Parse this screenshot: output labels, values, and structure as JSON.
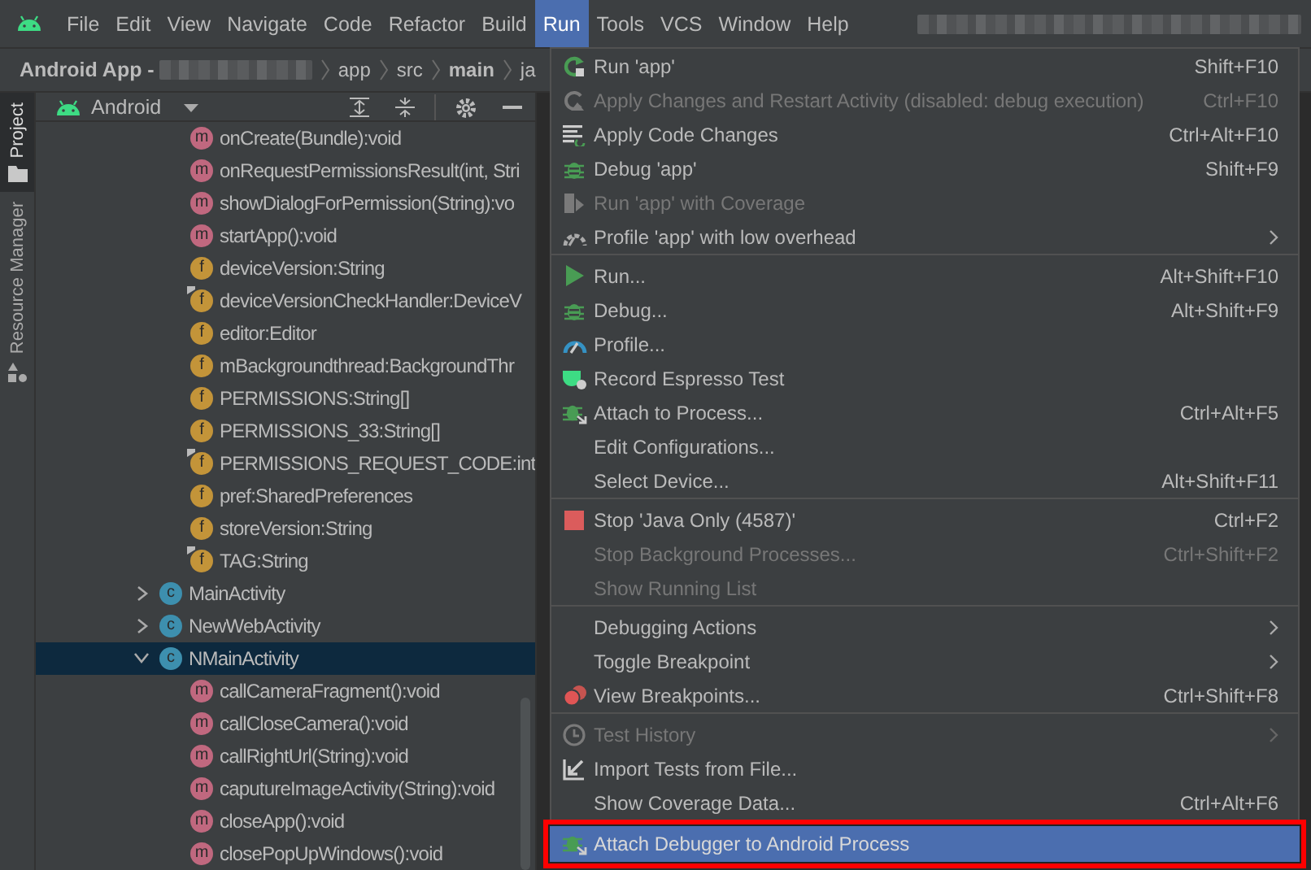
{
  "menu_bar": {
    "items": [
      {
        "label": "File",
        "selected": false
      },
      {
        "label": "Edit",
        "selected": false
      },
      {
        "label": "View",
        "selected": false
      },
      {
        "label": "Navigate",
        "selected": false
      },
      {
        "label": "Code",
        "selected": false
      },
      {
        "label": "Refactor",
        "selected": false
      },
      {
        "label": "Build",
        "selected": false
      },
      {
        "label": "Run",
        "selected": true
      },
      {
        "label": "Tools",
        "selected": false
      },
      {
        "label": "VCS",
        "selected": false
      },
      {
        "label": "Window",
        "selected": false
      },
      {
        "label": "Help",
        "selected": false
      }
    ]
  },
  "breadcrumbs": {
    "project": "Android App -",
    "parts": [
      "app",
      "src",
      "main",
      "ja"
    ]
  },
  "side_tabs": [
    {
      "label": "Project",
      "selected": true
    },
    {
      "label": "Resource Manager",
      "selected": false
    }
  ],
  "project_panel": {
    "view": "Android",
    "members": [
      {
        "label": "onCreate(Bundle):void",
        "kind": "method",
        "badge": "m",
        "static": false
      },
      {
        "label": "onRequestPermissionsResult(int, Stri",
        "kind": "method",
        "badge": "m",
        "static": false
      },
      {
        "label": "showDialogForPermission(String):vo",
        "kind": "method",
        "badge": "m",
        "static": false
      },
      {
        "label": "startApp():void",
        "kind": "method",
        "badge": "m",
        "static": false
      },
      {
        "label": "deviceVersion:String",
        "kind": "field",
        "badge": "f",
        "static": false
      },
      {
        "label": "deviceVersionCheckHandler:DeviceV",
        "kind": "field",
        "badge": "f",
        "static": true
      },
      {
        "label": "editor:Editor",
        "kind": "field",
        "badge": "f",
        "static": false
      },
      {
        "label": "mBackgroundthread:BackgroundThr",
        "kind": "field",
        "badge": "f",
        "static": false
      },
      {
        "label": "PERMISSIONS:String[]",
        "kind": "field",
        "badge": "f",
        "static": false
      },
      {
        "label": "PERMISSIONS_33:String[]",
        "kind": "field",
        "badge": "f",
        "static": false
      },
      {
        "label": "PERMISSIONS_REQUEST_CODE:int",
        "kind": "field",
        "badge": "f",
        "static": true
      },
      {
        "label": "pref:SharedPreferences",
        "kind": "field",
        "badge": "f",
        "static": false
      },
      {
        "label": "storeVersion:String",
        "kind": "field",
        "badge": "f",
        "static": false
      },
      {
        "label": "TAG:String",
        "kind": "field",
        "badge": "f",
        "static": true
      }
    ],
    "classes": [
      {
        "label": "MainActivity",
        "badge": "c",
        "expanded": false,
        "selected": false
      },
      {
        "label": "NewWebActivity",
        "badge": "c",
        "expanded": false,
        "selected": false
      },
      {
        "label": "NMainActivity",
        "badge": "c",
        "expanded": true,
        "selected": true,
        "children": [
          {
            "label": "callCameraFragment():void",
            "kind": "method",
            "badge": "m",
            "static": false
          },
          {
            "label": "callCloseCamera():void",
            "kind": "method",
            "badge": "m",
            "static": false
          },
          {
            "label": "callRightUrl(String):void",
            "kind": "method",
            "badge": "m",
            "static": false
          },
          {
            "label": "caputureImageActivity(String):void",
            "kind": "method",
            "badge": "m",
            "static": false
          },
          {
            "label": "closeApp():void",
            "kind": "method",
            "badge": "m",
            "static": false
          },
          {
            "label": "closePopUpWindows():void",
            "kind": "method",
            "badge": "m",
            "static": false
          }
        ]
      }
    ]
  },
  "run_menu": [
    {
      "kind": "item",
      "label": "Run 'app'",
      "shortcut": "Shift+F10",
      "disabled": false,
      "submenu": false,
      "selected": false,
      "annotated": false
    },
    {
      "kind": "item",
      "label": "Apply Changes and Restart Activity (disabled: debug execution)",
      "shortcut": "Ctrl+F10",
      "disabled": true,
      "submenu": false,
      "selected": false,
      "annotated": false
    },
    {
      "kind": "item",
      "label": "Apply Code Changes",
      "shortcut": "Ctrl+Alt+F10",
      "disabled": false,
      "submenu": false,
      "selected": false,
      "annotated": false
    },
    {
      "kind": "item",
      "label": "Debug 'app'",
      "shortcut": "Shift+F9",
      "disabled": false,
      "submenu": false,
      "selected": false,
      "annotated": false
    },
    {
      "kind": "item",
      "label": "Run 'app' with Coverage",
      "disabled": true,
      "submenu": false,
      "selected": false,
      "annotated": false
    },
    {
      "kind": "item",
      "label": "Profile 'app' with low overhead",
      "disabled": false,
      "submenu": true,
      "selected": false,
      "annotated": false
    },
    {
      "kind": "separator"
    },
    {
      "kind": "item",
      "label": "Run...",
      "shortcut": "Alt+Shift+F10",
      "disabled": false,
      "submenu": false,
      "selected": false,
      "annotated": false
    },
    {
      "kind": "item",
      "label": "Debug...",
      "shortcut": "Alt+Shift+F9",
      "disabled": false,
      "submenu": false,
      "selected": false,
      "annotated": false
    },
    {
      "kind": "item",
      "label": "Profile...",
      "disabled": false,
      "submenu": false,
      "selected": false,
      "annotated": false
    },
    {
      "kind": "item",
      "label": "Record Espresso Test",
      "disabled": false,
      "submenu": false,
      "selected": false,
      "annotated": false
    },
    {
      "kind": "item",
      "label": "Attach to Process...",
      "shortcut": "Ctrl+Alt+F5",
      "disabled": false,
      "submenu": false,
      "selected": false,
      "annotated": false
    },
    {
      "kind": "item",
      "label": "Edit Configurations...",
      "disabled": false,
      "submenu": false,
      "selected": false,
      "annotated": false
    },
    {
      "kind": "item",
      "label": "Select Device...",
      "shortcut": "Alt+Shift+F11",
      "disabled": false,
      "submenu": false,
      "selected": false,
      "annotated": false
    },
    {
      "kind": "separator"
    },
    {
      "kind": "item",
      "label": "Stop 'Java Only (4587)'",
      "shortcut": "Ctrl+F2",
      "disabled": false,
      "submenu": false,
      "selected": false,
      "annotated": false
    },
    {
      "kind": "item",
      "label": "Stop Background Processes...",
      "shortcut": "Ctrl+Shift+F2",
      "disabled": true,
      "submenu": false,
      "selected": false,
      "annotated": false
    },
    {
      "kind": "item",
      "label": "Show Running List",
      "disabled": true,
      "submenu": false,
      "selected": false,
      "annotated": false
    },
    {
      "kind": "separator"
    },
    {
      "kind": "item",
      "label": "Debugging Actions",
      "disabled": false,
      "submenu": true,
      "selected": false,
      "annotated": false
    },
    {
      "kind": "item",
      "label": "Toggle Breakpoint",
      "disabled": false,
      "submenu": true,
      "selected": false,
      "annotated": false
    },
    {
      "kind": "item",
      "label": "View Breakpoints...",
      "shortcut": "Ctrl+Shift+F8",
      "disabled": false,
      "submenu": false,
      "selected": false,
      "annotated": false
    },
    {
      "kind": "separator"
    },
    {
      "kind": "item",
      "label": "Test History",
      "disabled": true,
      "submenu": true,
      "selected": false,
      "annotated": false
    },
    {
      "kind": "item",
      "label": "Import Tests from File...",
      "disabled": false,
      "submenu": false,
      "selected": false,
      "annotated": false
    },
    {
      "kind": "item",
      "label": "Show Coverage Data...",
      "shortcut": "Ctrl+Alt+F6",
      "disabled": false,
      "submenu": false,
      "selected": false,
      "annotated": false
    },
    {
      "kind": "item",
      "label": "Attach Debugger to Android Process",
      "disabled": false,
      "submenu": false,
      "selected": true,
      "annotated": true
    }
  ]
}
